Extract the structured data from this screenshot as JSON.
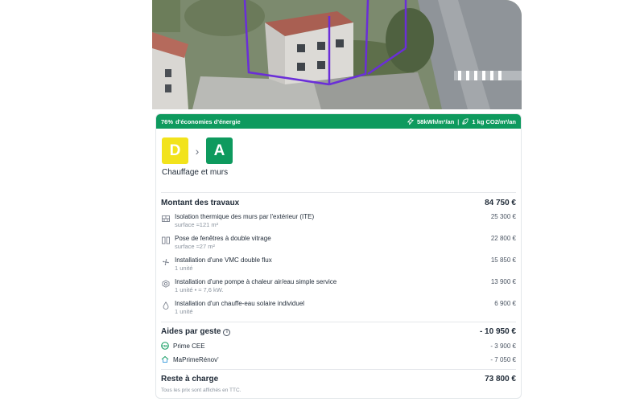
{
  "banner": {
    "savings_percent": "76%",
    "savings_label": "d'économies d'énergie",
    "energy_value": "58kWh/m²/an",
    "co2_value": "1 kg CO2/m²/an"
  },
  "grades": {
    "from": "D",
    "to": "A",
    "from_color": "#f2e31c",
    "to_color": "#0e9a5e"
  },
  "category": "Chauffage et murs",
  "works": {
    "title": "Montant des travaux",
    "total": "84 750 €",
    "items": [
      {
        "icon": "wall-insulation-icon",
        "label": "Isolation thermique des murs par l'extérieur (ITE)",
        "sub": "surface ≈121 m²",
        "amount": "25 300 €"
      },
      {
        "icon": "window-icon",
        "label": "Pose de fenêtres à double vitrage",
        "sub": "surface ≈27 m²",
        "amount": "22 800 €"
      },
      {
        "icon": "fan-icon",
        "label": "Installation d'une VMC double flux",
        "sub": "1 unité",
        "amount": "15 850 €"
      },
      {
        "icon": "heat-pump-icon",
        "label": "Installation d'une pompe à chaleur air/eau simple service",
        "sub": "1 unité • ≈ 7,6 kW.",
        "amount": "13 900 €"
      },
      {
        "icon": "water-drop-icon",
        "label": "Installation d'un chauffe-eau solaire individuel",
        "sub": "1 unité",
        "amount": "6 900 €"
      }
    ]
  },
  "aids": {
    "title": "Aides par geste",
    "total": "- 10 950 €",
    "items": [
      {
        "icon": "cee-icon",
        "label": "Prime CEE",
        "amount": "- 3 900 €"
      },
      {
        "icon": "maprimerenov-icon",
        "label": "MaPrimeRénov'",
        "amount": "- 7 050 €"
      }
    ]
  },
  "remaining": {
    "label": "Reste à charge",
    "amount": "73 800 €"
  },
  "note": "Tous les prix sont affichés en TTC."
}
